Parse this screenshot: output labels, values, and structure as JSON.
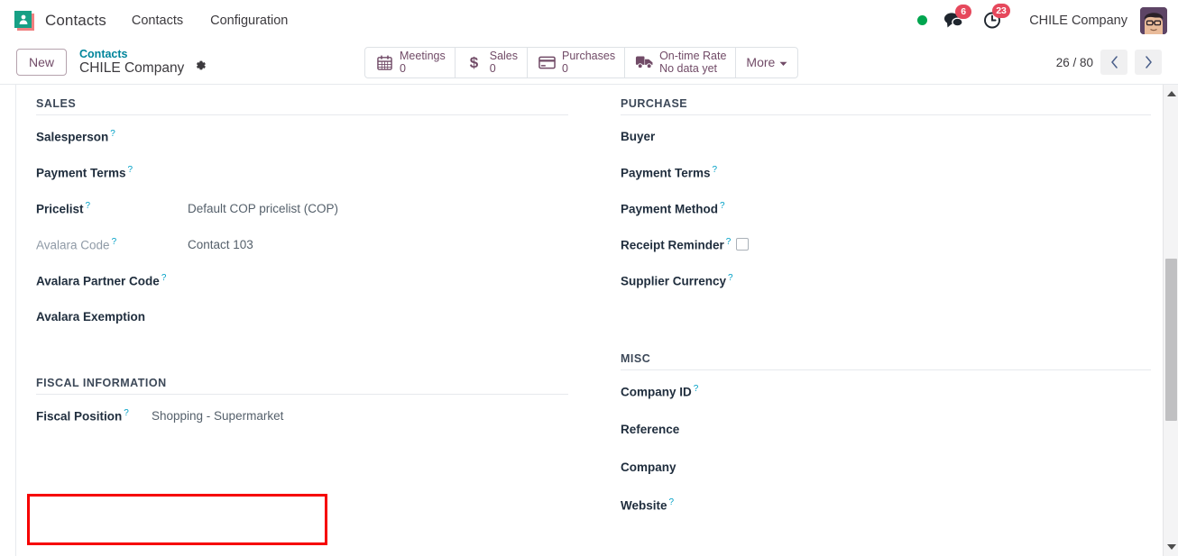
{
  "navbar": {
    "app_icon_name": "contacts-app-icon",
    "app_title": "Contacts",
    "menu_items": [
      {
        "label": "Contacts",
        "name": "menu-contacts"
      },
      {
        "label": "Configuration",
        "name": "menu-configuration"
      }
    ],
    "status_dot_color": "#00a54f",
    "messages_badge": "6",
    "activities_badge": "23",
    "company_name": "CHILE Company",
    "avatar_name": "user-avatar"
  },
  "control_panel": {
    "new_label": "New",
    "breadcrumb_parent": "Contacts",
    "breadcrumb_current": "CHILE Company",
    "gear_icon": "gear-icon",
    "stat_buttons": [
      {
        "icon": "calendar-icon",
        "label": "Meetings",
        "value": "0"
      },
      {
        "icon": "dollar-icon",
        "label": "Sales",
        "value": "0"
      },
      {
        "icon": "credit-card-icon",
        "label": "Purchases",
        "value": "0"
      },
      {
        "icon": "truck-icon",
        "label": "On-time Rate",
        "value": "No data yet"
      }
    ],
    "more_label": "More",
    "pager_count": "26 / 80",
    "prev_label": "‹",
    "next_label": "›"
  },
  "form": {
    "groups": [
      {
        "name": "sales",
        "title": "SALES",
        "side": "left",
        "fields": [
          {
            "label": "Salesperson",
            "help": true,
            "value": "",
            "muted": false
          },
          {
            "label": "Payment Terms",
            "help": true,
            "value": "",
            "muted": false
          },
          {
            "label": "Pricelist",
            "help": true,
            "value": "Default COP pricelist (COP)",
            "muted": false
          },
          {
            "label": "Avalara Code",
            "help": true,
            "value": "Contact 103",
            "muted": true
          },
          {
            "label": "Avalara Partner Code",
            "help": true,
            "value": "",
            "muted": false
          },
          {
            "label": "Avalara Exemption",
            "help": false,
            "value": "",
            "muted": false
          }
        ]
      },
      {
        "name": "fiscal-information",
        "title": "FISCAL INFORMATION",
        "side": "left",
        "fields": [
          {
            "label": "Fiscal Position",
            "help": true,
            "value": "Shopping - Supermarket",
            "muted": false
          }
        ]
      },
      {
        "name": "purchase",
        "title": "PURCHASE",
        "side": "right",
        "fields": [
          {
            "label": "Buyer",
            "help": false,
            "value": "",
            "muted": false
          },
          {
            "label": "Payment Terms",
            "help": true,
            "value": "",
            "muted": false
          },
          {
            "label": "Payment Method",
            "help": true,
            "value": "",
            "muted": false
          },
          {
            "label": "Receipt Reminder",
            "help": true,
            "value": "",
            "muted": false,
            "checkbox": true
          },
          {
            "label": "Supplier Currency",
            "help": true,
            "value": "",
            "muted": false
          }
        ]
      },
      {
        "name": "misc",
        "title": "MISC",
        "side": "right",
        "fields": [
          {
            "label": "Company ID",
            "help": true,
            "value": "",
            "muted": false
          },
          {
            "label": "Reference",
            "help": false,
            "value": "",
            "muted": false
          },
          {
            "label": "Company",
            "help": false,
            "value": "",
            "muted": false
          },
          {
            "label": "Website",
            "help": true,
            "value": "",
            "muted": false
          }
        ]
      }
    ]
  },
  "annotation": {
    "highlight_color": "#f60000",
    "highlight_target": "Fiscal Position"
  }
}
